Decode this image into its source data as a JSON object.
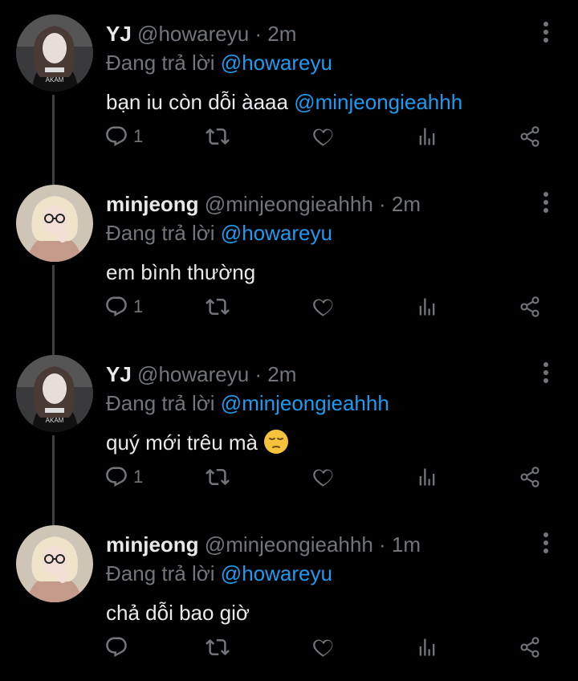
{
  "replying_prefix": "Đang trả lời",
  "tweets": [
    {
      "name": "YJ",
      "handle": "@howareyu",
      "time": "2m",
      "replying_to": "@howareyu",
      "text": "bạn iu còn dỗi àaaa",
      "text_mention": "@minjeongieahhh",
      "reply_count": "1",
      "avatar": "yj-avatar"
    },
    {
      "name": "minjeong",
      "handle": "@minjeongieahhh",
      "time": "2m",
      "replying_to": "@howareyu",
      "text": "em bình thường",
      "reply_count": "1",
      "avatar": "minjeong-avatar"
    },
    {
      "name": "YJ",
      "handle": "@howareyu",
      "time": "2m",
      "replying_to": "@minjeongieahhh",
      "text": "quý mới trêu mà",
      "emoji": "pensive-face",
      "reply_count": "1",
      "avatar": "yj-avatar"
    },
    {
      "name": "minjeong",
      "handle": "@minjeongieahhh",
      "time": "1m",
      "replying_to": "@howareyu",
      "text": "chả dỗi bao giờ",
      "reply_count": "",
      "avatar": "minjeong-avatar"
    }
  ],
  "colors": {
    "background": "#000000",
    "text": "#e7e9ea",
    "secondary": "#71767b",
    "accent": "#1d9bf0",
    "thread_line": "#3e4144"
  },
  "icons": [
    "reply-icon",
    "retweet-icon",
    "like-icon",
    "views-icon",
    "share-icon",
    "more-icon"
  ]
}
